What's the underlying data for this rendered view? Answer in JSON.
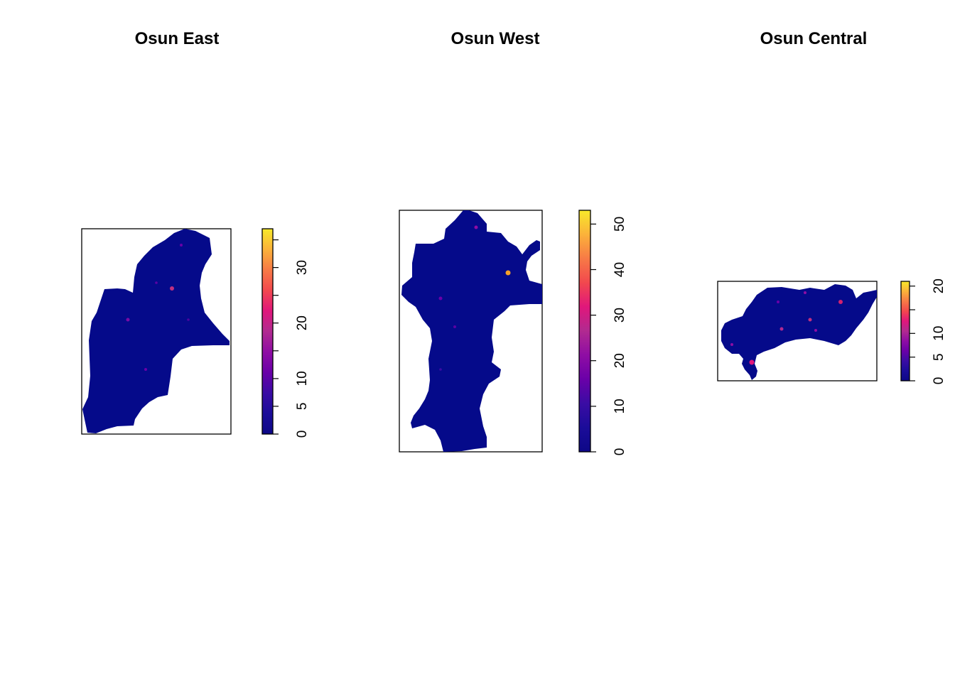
{
  "figure": {
    "colors": {
      "fill_base": "#050A8A",
      "frame": "#000000",
      "palette": [
        "#0D0887",
        "#1B0C99",
        "#3A0CA4",
        "#6A00A8",
        "#8F0DA4",
        "#B12A90",
        "#CC4778",
        "#E16462",
        "#F2844B",
        "#FCA636",
        "#FCCE25",
        "#F0F921"
      ]
    }
  },
  "chart_data": [
    {
      "type": "heatmap",
      "title": "Osun East",
      "legend_ticks": [
        0,
        5,
        10,
        15,
        20,
        25,
        30,
        35
      ],
      "legend_tick_labels": [
        "0",
        "5",
        "10",
        "20",
        "30"
      ],
      "value_range": [
        0,
        37
      ],
      "hotspots": [
        {
          "value": 22
        },
        {
          "value": 12
        },
        {
          "value": 9
        },
        {
          "value": 8
        },
        {
          "value": 7
        },
        {
          "value": 6
        }
      ]
    },
    {
      "type": "heatmap",
      "title": "Osun West",
      "legend_ticks": [
        0,
        10,
        20,
        30,
        40,
        50
      ],
      "legend_tick_labels": [
        "0",
        "10",
        "20",
        "30",
        "40",
        "50"
      ],
      "value_range": [
        0,
        53
      ],
      "hotspots": [
        {
          "value": 30
        },
        {
          "value": 14
        },
        {
          "value": 10
        },
        {
          "value": 9
        },
        {
          "value": 6
        }
      ]
    },
    {
      "type": "heatmap",
      "title": "Osun Central",
      "legend_ticks": [
        0,
        5,
        10,
        15,
        20
      ],
      "legend_tick_labels": [
        "0",
        "5",
        "10",
        "20"
      ],
      "value_range": [
        0,
        21
      ],
      "hotspots": [
        {
          "value": 17
        },
        {
          "value": 15
        },
        {
          "value": 12
        },
        {
          "value": 11
        },
        {
          "value": 10
        },
        {
          "value": 9
        },
        {
          "value": 9
        },
        {
          "value": 8
        }
      ]
    }
  ]
}
